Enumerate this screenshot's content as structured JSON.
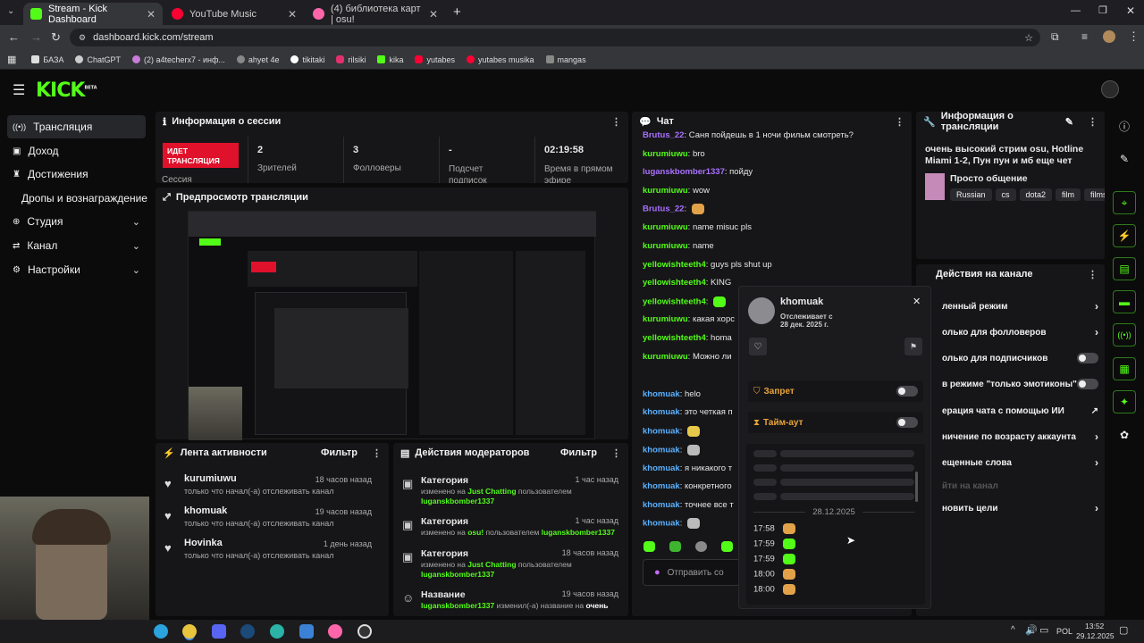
{
  "browser": {
    "tabs": [
      {
        "title": "Stream - Kick Dashboard",
        "color": "#53fc18"
      },
      {
        "title": "YouTube Music",
        "color": "#ff0033"
      },
      {
        "title": "(4) библиотека карт | osu!",
        "color": "#ff66aa"
      }
    ],
    "url": "dashboard.kick.com/stream",
    "bookmarks": [
      "БАЗА",
      "ChatGPT",
      "(2) a4techerx7 - инф...",
      "ahyet 4e",
      "tikitaki",
      "rilsiki",
      "kika",
      "yutabes",
      "yutabes musika",
      "mangas"
    ]
  },
  "brand": {
    "logo": "KICK",
    "beta": "BETA",
    "accent": "#53fc18"
  },
  "sidebar": {
    "items": [
      {
        "label": "Трансляция",
        "icon": "broadcast-icon"
      },
      {
        "label": "Доход",
        "icon": "money-icon"
      },
      {
        "label": "Достижения",
        "icon": "trophy-icon"
      },
      {
        "label": "Дропы и вознаграждение"
      },
      {
        "label": "Студия",
        "icon": "studio-icon"
      },
      {
        "label": "Канал",
        "icon": "channel-icon"
      },
      {
        "label": "Настройки",
        "icon": "gear-icon"
      }
    ]
  },
  "session": {
    "title": "Информация о сессии",
    "live_badge": "ИДЕТ ТРАНСЛЯЦИЯ",
    "session_label": "Сессия",
    "stats": [
      {
        "value": "2",
        "label": "Зрителей"
      },
      {
        "value": "3",
        "label": "Фолловеры"
      },
      {
        "value": "-",
        "label": "Подсчет подписок"
      },
      {
        "value": "02:19:58",
        "label": "Время в прямом эфире"
      }
    ]
  },
  "preview": {
    "title": "Предпросмотр трансляции"
  },
  "activity": {
    "title": "Лента активности",
    "filter": "Фильтр",
    "items": [
      {
        "name": "kurumiuwu",
        "desc": "только что начал(-а) отслеживать канал",
        "time": "18 часов назад"
      },
      {
        "name": "khomuak",
        "desc": "только что начал(-а) отслеживать канал",
        "time": "19 часов назад"
      },
      {
        "name": "Hovinka",
        "desc": "только что начал(-а) отслеживать канал",
        "time": "1 день назад"
      }
    ]
  },
  "modactions": {
    "title": "Действия модераторов",
    "filter": "Фильтр",
    "items": [
      {
        "title": "Категория",
        "time": "1 час назад",
        "pre": "изменено на",
        "val": "Just Chatting",
        "mid": "пользователем",
        "user": "luganskbomber1337"
      },
      {
        "title": "Категория",
        "time": "1 час назад",
        "pre": "изменено на",
        "val": "osu!",
        "mid": "пользователем",
        "user": "luganskbomber1337"
      },
      {
        "title": "Категория",
        "time": "18 часов назад",
        "pre": "изменено на",
        "val": "Just Chatting",
        "mid": "пользователем",
        "user": "luganskbomber1337"
      },
      {
        "title": "Название",
        "time": "19 часов назад",
        "pre": "luganskbomber1337",
        "val": "",
        "mid": "изменил(-а) название на",
        "user": "очень"
      }
    ]
  },
  "chat": {
    "title": "Чат",
    "placeholder": "Отправить со",
    "lines": [
      {
        "user": "Brutus_22",
        "color": "#a970ff",
        "text": "Саня пойдешь в 1 ночи фильм смотреть?"
      },
      {
        "user": "kurumiuwu",
        "color": "#53fc18",
        "text": "bro"
      },
      {
        "user": "luganskbomber1337",
        "color": "#a970ff",
        "text": "пойду"
      },
      {
        "user": "kurumiuwu",
        "color": "#53fc18",
        "text": "wow"
      },
      {
        "user": "Brutus_22",
        "color": "#a970ff",
        "text": ""
      },
      {
        "user": "kurumiuwu",
        "color": "#53fc18",
        "text": "name misuc pls"
      },
      {
        "user": "kurumiuwu",
        "color": "#53fc18",
        "text": "name"
      },
      {
        "user": "yellowishteeth4",
        "color": "#53fc18",
        "text": "guys pls shut up"
      },
      {
        "user": "yellowishteeth4",
        "color": "#53fc18",
        "text": "KING"
      },
      {
        "user": "yellowishteeth4",
        "color": "#53fc18",
        "text": ""
      },
      {
        "user": "kurumiuwu",
        "color": "#53fc18",
        "text": "какая хорс"
      },
      {
        "user": "yellowishteeth4",
        "color": "#53fc18",
        "text": "homa"
      },
      {
        "user": "kurumiuwu",
        "color": "#53fc18",
        "text": "Можно ли"
      },
      {
        "user": "khomuak",
        "color": "#5ab0ff",
        "text": "helo"
      },
      {
        "user": "khomuak",
        "color": "#5ab0ff",
        "text": "это четкая п"
      },
      {
        "user": "khomuak",
        "color": "#5ab0ff",
        "text": ""
      },
      {
        "user": "khomuak",
        "color": "#5ab0ff",
        "text": ""
      },
      {
        "user": "khomuak",
        "color": "#5ab0ff",
        "text": "я никакого т"
      },
      {
        "user": "khomuak",
        "color": "#5ab0ff",
        "text": "конкретного"
      },
      {
        "user": "khomuak",
        "color": "#5ab0ff",
        "text": "точнее все т"
      },
      {
        "user": "khomuak",
        "color": "#5ab0ff",
        "text": ""
      }
    ]
  },
  "streaminfo": {
    "title": "Информация о трансляции",
    "stream_title": "очень высокий стрим osu, Hotline Miami 1-2, Пун пун и мб еще чет",
    "category": "Просто общение",
    "tags": [
      "Russian",
      "cs",
      "dota2",
      "film",
      "films"
    ]
  },
  "channel_actions": {
    "title": "Действия на канале",
    "items": [
      {
        "label": "ленный режим",
        "ctrl": "chevron"
      },
      {
        "label": "олько для фолловеров",
        "ctrl": "chevron"
      },
      {
        "label": "олько для подписчиков",
        "ctrl": "toggle"
      },
      {
        "label": "в режиме \"только эмотиконы\"",
        "ctrl": "toggle"
      },
      {
        "label": "ерация чата с помощью ИИ",
        "ctrl": "external"
      },
      {
        "label": "ничение по возрасту аккаунта",
        "ctrl": "chevron"
      },
      {
        "label": "ещенные слова",
        "ctrl": "chevron"
      },
      {
        "label": "йти на канал",
        "ctrl": "none"
      },
      {
        "label": "новить цели",
        "ctrl": "chevron"
      }
    ]
  },
  "user_card": {
    "username": "khomuak",
    "following_label": "Отслеживает с",
    "following_date": "28 дек. 2025 г.",
    "ban_label": "Запрет",
    "timeout_label": "Тайм-аут",
    "date_sep": "28.12.2025",
    "messages": [
      "17:58",
      "17:59",
      "17:59",
      "18:00",
      "18:00"
    ]
  },
  "taskbar": {
    "lang": "POL",
    "time": "13:52",
    "date": "29.12.2025"
  }
}
